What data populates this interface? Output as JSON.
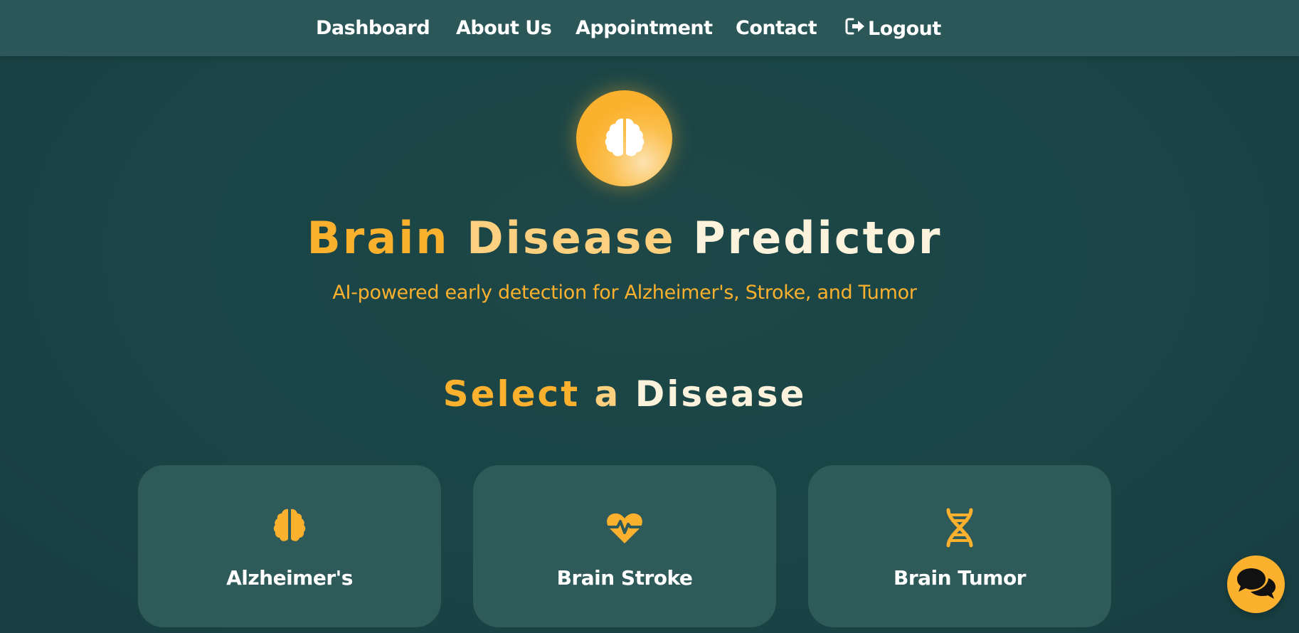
{
  "nav": {
    "items": [
      {
        "label": "Dashboard"
      },
      {
        "label": "About Us"
      },
      {
        "label": "Appointment"
      },
      {
        "label": "Contact"
      },
      {
        "label": "Logout",
        "icon": "logout-icon"
      }
    ]
  },
  "hero": {
    "logo_icon": "brain-icon",
    "title_part1": "Brain",
    "title_part2": "Disease",
    "title_part3": "Predictor",
    "subtitle": "AI-powered early detection for Alzheimer's, Stroke, and Tumor"
  },
  "section": {
    "title_part1": "Select",
    "title_part2": "a",
    "title_part3": "Disease"
  },
  "cards": [
    {
      "label": "Alzheimer's",
      "icon": "brain-icon"
    },
    {
      "label": "Brain Stroke",
      "icon": "heart-pulse-icon"
    },
    {
      "label": "Brain Tumor",
      "icon": "dna-icon"
    }
  ],
  "chat": {
    "icon": "chat-icon"
  },
  "colors": {
    "accent": "#fbb12e",
    "background": "#1a4546",
    "navbar": "#2c5758",
    "card": "#2f5a5a"
  }
}
